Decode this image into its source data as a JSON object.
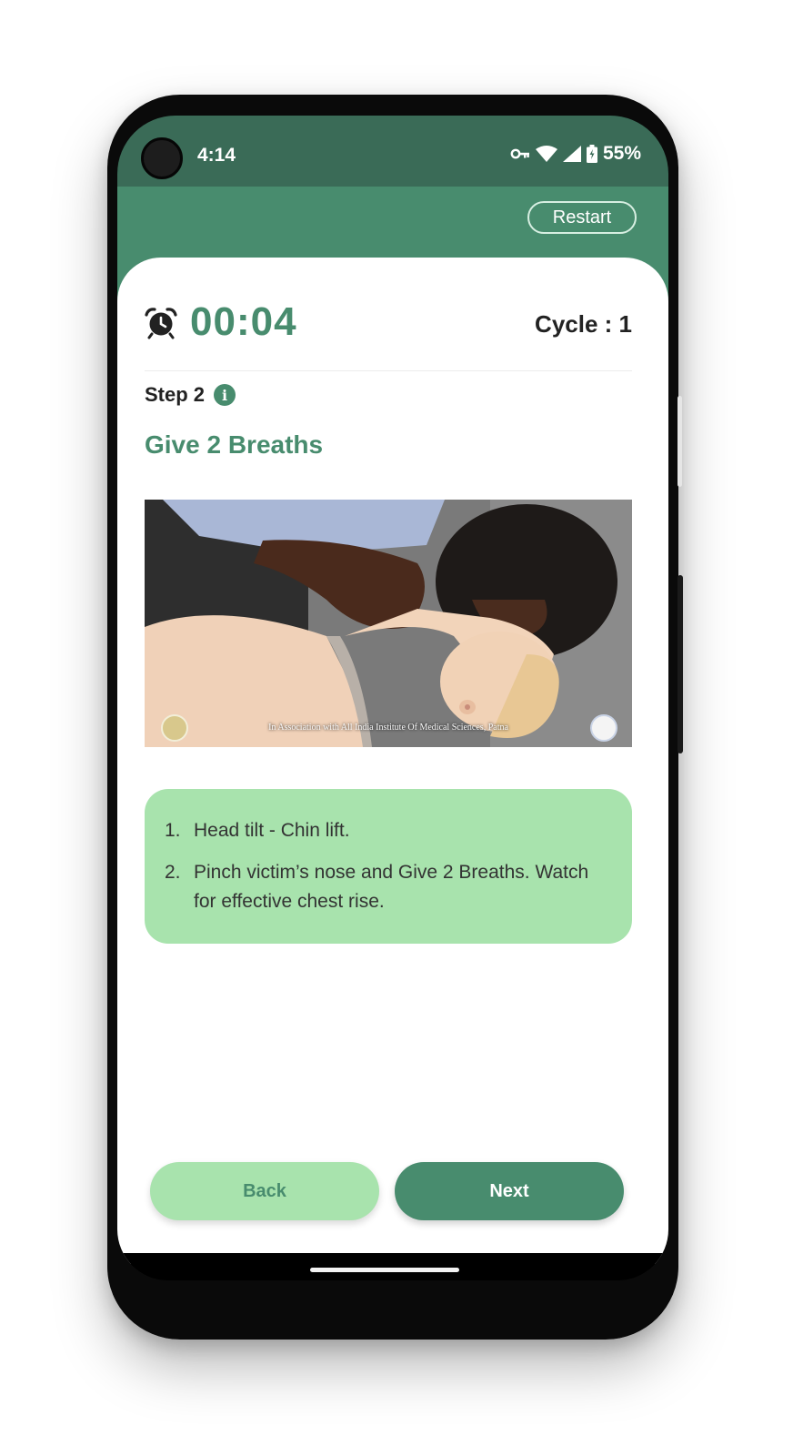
{
  "status_bar": {
    "time": "4:14",
    "battery": "55%",
    "icons": [
      "vpn-key-icon",
      "wifi-icon",
      "cell-signal-icon",
      "battery-charging-icon"
    ]
  },
  "header": {
    "restart_label": "Restart"
  },
  "timer": {
    "value": "00:04",
    "cycle_label": "Cycle : 1",
    "icon": "alarm-clock-icon"
  },
  "step": {
    "label": "Step 2",
    "info_icon": "info-icon",
    "title": "Give 2 Breaths"
  },
  "image": {
    "caption": "In Association with All India Institute Of Medical Sciences, Patna"
  },
  "instructions": [
    {
      "num": "1.",
      "text": "Head tilt - Chin lift."
    },
    {
      "num": "2.",
      "text": "Pinch victim’s nose and Give 2 Breaths. Watch for effective chest rise."
    }
  ],
  "buttons": {
    "back": "Back",
    "next": "Next"
  },
  "colors": {
    "primary": "#488c6e",
    "status_bar": "#3a6b57",
    "light_green": "#a8e3ad"
  }
}
